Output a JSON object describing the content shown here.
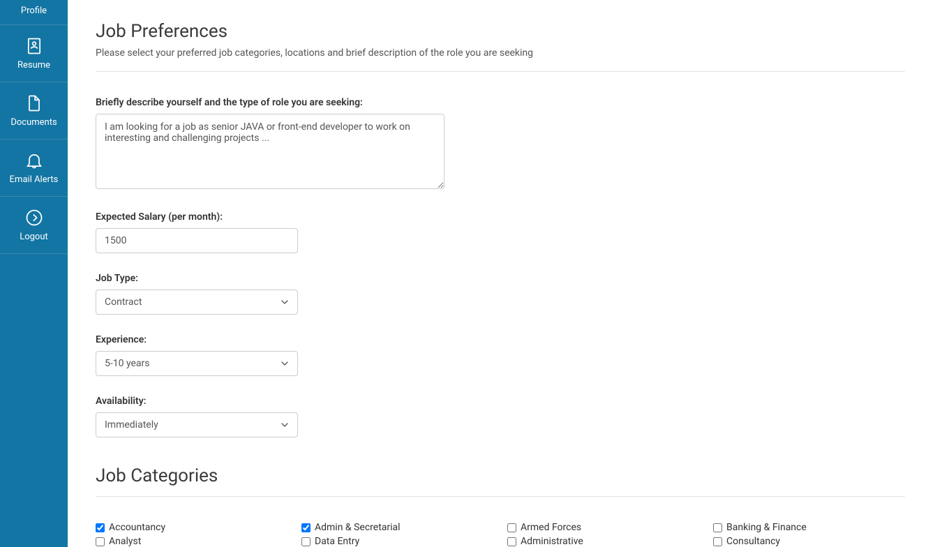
{
  "sidebar": {
    "items": [
      {
        "label": "Profile"
      },
      {
        "label": "Resume"
      },
      {
        "label": "Documents"
      },
      {
        "label": "Email Alerts"
      },
      {
        "label": "Logout"
      }
    ]
  },
  "page": {
    "title": "Job Preferences",
    "subtitle": "Please select your preferred job categories, locations and brief description of the role you are seeking"
  },
  "form": {
    "description_label": "Briefly describe yourself and the type of role you are seeking:",
    "description_value": "I am looking for a job as senior JAVA or front-end developer to work on interesting and challenging projects ...",
    "salary_label": "Expected Salary (per month):",
    "salary_value": "1500",
    "jobtype_label": "Job Type:",
    "jobtype_value": "Contract",
    "experience_label": "Experience:",
    "experience_value": "5-10 years",
    "availability_label": "Availability:",
    "availability_value": "Immediately"
  },
  "categories": {
    "title": "Job Categories",
    "items": [
      {
        "label": "Accountancy",
        "checked": true
      },
      {
        "label": "Admin & Secretarial",
        "checked": true
      },
      {
        "label": "Armed Forces",
        "checked": false
      },
      {
        "label": "Banking & Finance",
        "checked": false
      },
      {
        "label": "Analyst",
        "checked": false
      },
      {
        "label": "Data Entry",
        "checked": false
      },
      {
        "label": "Administrative",
        "checked": false
      },
      {
        "label": "Consultancy",
        "checked": false
      }
    ]
  }
}
